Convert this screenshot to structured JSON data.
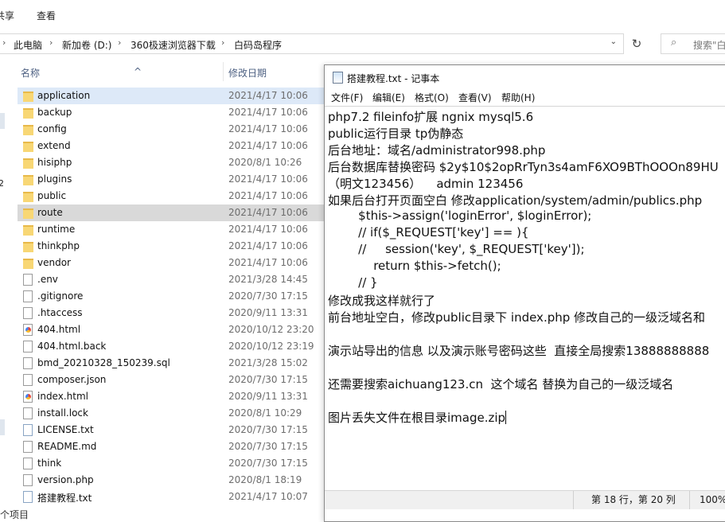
{
  "ribbon": {
    "share": "共享",
    "view": "查看"
  },
  "address": {
    "crumbs": [
      "此电脑",
      "新加卷 (D:)",
      "360极速浏览器下载",
      "白码岛程序"
    ],
    "search_placeholder": "搜索\"白"
  },
  "columns": {
    "name": "名称",
    "date": "修改日期"
  },
  "files": [
    {
      "name": "application",
      "date": "2021/4/17 10:06",
      "kind": "folder"
    },
    {
      "name": "backup",
      "date": "2021/4/17 10:06",
      "kind": "folder"
    },
    {
      "name": "config",
      "date": "2021/4/17 10:06",
      "kind": "folder"
    },
    {
      "name": "extend",
      "date": "2021/4/17 10:06",
      "kind": "folder"
    },
    {
      "name": "hisiphp",
      "date": "2020/8/1 10:26",
      "kind": "folder"
    },
    {
      "name": "plugins",
      "date": "2021/4/17 10:06",
      "kind": "folder"
    },
    {
      "name": "public",
      "date": "2021/4/17 10:06",
      "kind": "folder"
    },
    {
      "name": "route",
      "date": "2021/4/17 10:06",
      "kind": "folder"
    },
    {
      "name": "runtime",
      "date": "2021/4/17 10:06",
      "kind": "folder"
    },
    {
      "name": "thinkphp",
      "date": "2021/4/17 10:06",
      "kind": "folder"
    },
    {
      "name": "vendor",
      "date": "2021/4/17 10:06",
      "kind": "folder"
    },
    {
      "name": ".env",
      "date": "2021/3/28 14:45",
      "kind": "file"
    },
    {
      "name": ".gitignore",
      "date": "2020/7/30 17:15",
      "kind": "file"
    },
    {
      "name": ".htaccess",
      "date": "2020/9/11 13:31",
      "kind": "file"
    },
    {
      "name": "404.html",
      "date": "2020/10/12 23:20",
      "kind": "html"
    },
    {
      "name": "404.html.back",
      "date": "2020/10/12 23:19",
      "kind": "file"
    },
    {
      "name": "bmd_20210328_150239.sql",
      "date": "2021/3/28 15:02",
      "kind": "file"
    },
    {
      "name": "composer.json",
      "date": "2020/7/30 17:15",
      "kind": "file"
    },
    {
      "name": "index.html",
      "date": "2020/9/11 13:31",
      "kind": "html"
    },
    {
      "name": "install.lock",
      "date": "2020/8/1 10:29",
      "kind": "file"
    },
    {
      "name": "LICENSE.txt",
      "date": "2020/7/30 17:15",
      "kind": "txt"
    },
    {
      "name": "README.md",
      "date": "2020/7/30 17:15",
      "kind": "file"
    },
    {
      "name": "think",
      "date": "2020/7/30 17:15",
      "kind": "file"
    },
    {
      "name": "version.php",
      "date": "2020/8/1 18:19",
      "kind": "file"
    },
    {
      "name": "搭建教程.txt",
      "date": "2021/4/17 10:07",
      "kind": "txt"
    }
  ],
  "selected_file": "application",
  "hovered_file": "route",
  "left_pane_fragment": "2",
  "status_bar": "个项目",
  "notepad": {
    "title": "搭建教程.txt - 记事本",
    "menu": [
      "文件(F)",
      "编辑(E)",
      "格式(O)",
      "查看(V)",
      "帮助(H)"
    ],
    "lines": [
      "php7.2 fileinfo扩展 ngnix mysql5.6",
      "public运行目录 tp伪静态",
      "后台地址：域名/administrator998.php",
      "后台数据库替换密码 $2y$10$2opRrTyn3s4amF6XO9BThOOOn89HU",
      "（明文123456）    admin 123456",
      "如果后台打开页面空白 修改application/system/admin/publics.php",
      "        $this->assign('loginError', $loginError);",
      "        // if($_REQUEST['key'] == ){",
      "        //     session('key', $_REQUEST['key']);",
      "            return $this->fetch();",
      "        // }",
      "修改成我这样就行了",
      "前台地址空白，修改public目录下 index.php 修改自己的一级泛域名和",
      "",
      "演示站导出的信息 以及演示账号密码这些  直接全局搜索13888888888",
      "",
      "还需要搜索aichuang123.cn  这个域名 替换为自己的一级泛域名",
      "",
      "图片丢失文件在根目录image.zip"
    ],
    "status_position": "第 18 行，第 20 列",
    "zoom": "100%"
  }
}
